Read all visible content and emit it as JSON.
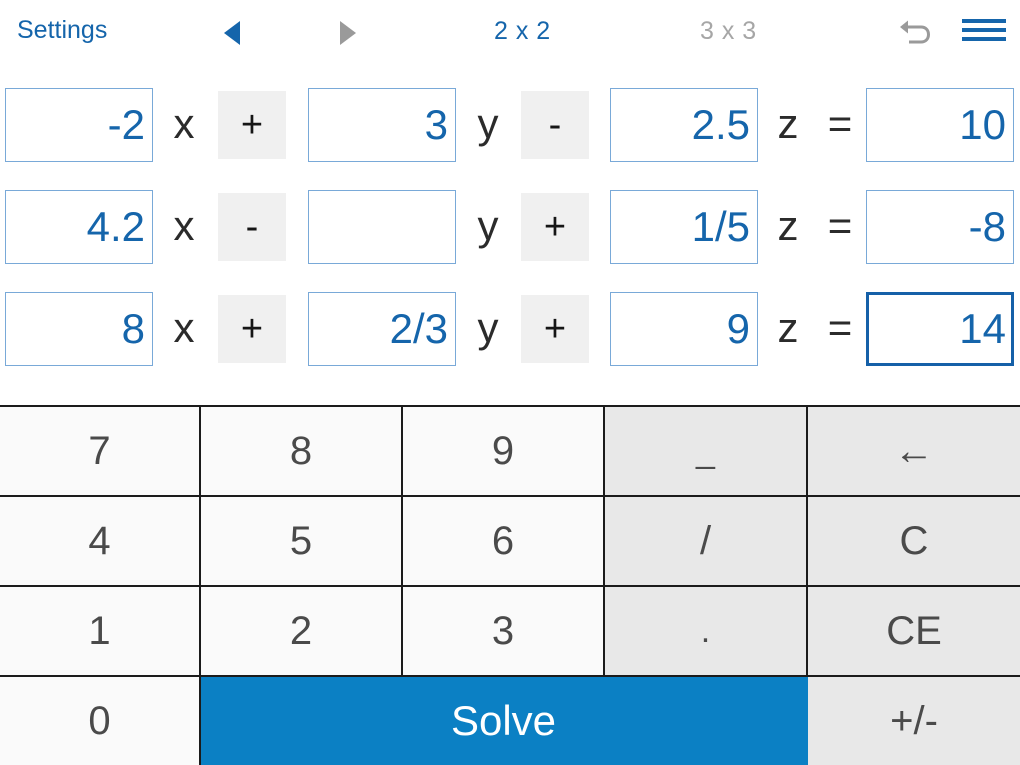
{
  "toolbar": {
    "settings_label": "Settings",
    "prev_icon": "triangle-left-icon",
    "next_icon": "triangle-right-icon",
    "prev_color": "#1565ab",
    "next_color": "#9a9a9a",
    "tab_2x2": "2 x 2",
    "tab_3x3": "3 x 3",
    "tab_active_color": "#1565ab",
    "tab_inactive_color": "#a6a6a6",
    "undo_icon": "undo-arrow-icon",
    "undo_color": "#9a9a9a",
    "menu_icon": "hamburger-menu-icon",
    "menu_color": "#1565ab"
  },
  "equations": {
    "variables": [
      "x",
      "y",
      "z"
    ],
    "equals_symbol": "=",
    "rows": [
      {
        "x": "-2",
        "op1": "+",
        "y": "3",
        "op2": "-",
        "z": "2.5",
        "result": "10",
        "focused": false
      },
      {
        "x": "4.2",
        "op1": "-",
        "y": "",
        "op2": "+",
        "z": "1/5",
        "result": "-8",
        "focused": false
      },
      {
        "x": "8",
        "op1": "+",
        "y": "2/3",
        "op2": "+",
        "z": "9",
        "result": "14",
        "focused": true
      }
    ]
  },
  "keypad": {
    "keys": [
      {
        "label": "7",
        "type": "digit"
      },
      {
        "label": "8",
        "type": "digit"
      },
      {
        "label": "9",
        "type": "digit"
      },
      {
        "label": "_",
        "type": "fn",
        "name": "minus-key"
      },
      {
        "label": "←",
        "type": "fn",
        "name": "backspace-key"
      },
      {
        "label": "4",
        "type": "digit"
      },
      {
        "label": "5",
        "type": "digit"
      },
      {
        "label": "6",
        "type": "digit"
      },
      {
        "label": "/",
        "type": "fn",
        "name": "divide-key"
      },
      {
        "label": "C",
        "type": "fn",
        "name": "clear-key"
      },
      {
        "label": "1",
        "type": "digit"
      },
      {
        "label": "2",
        "type": "digit"
      },
      {
        "label": "3",
        "type": "digit"
      },
      {
        "label": ".",
        "type": "fn",
        "name": "decimal-key"
      },
      {
        "label": "CE",
        "type": "fn",
        "name": "clear-entry-key"
      },
      {
        "label": "0",
        "type": "digit"
      },
      {
        "label": "Solve",
        "type": "solve",
        "name": "solve-key"
      },
      {
        "label": "+/-",
        "type": "fn",
        "name": "sign-toggle-key"
      }
    ],
    "solve_color": "#0b80c4"
  }
}
